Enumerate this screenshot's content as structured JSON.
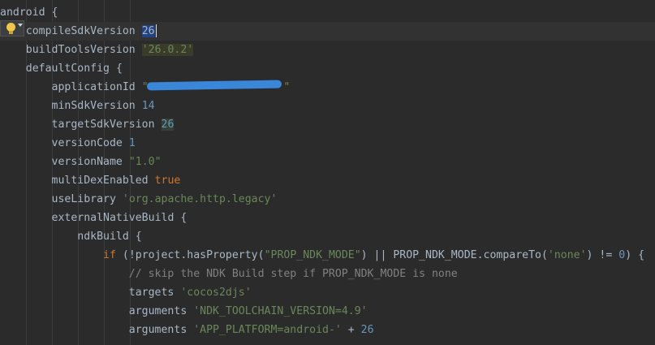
{
  "code": {
    "l1": {
      "ident": "android",
      "brace": "{"
    },
    "l2": {
      "ident": "compileSdkVersion",
      "value": "26"
    },
    "l3": {
      "ident": "buildToolsVersion",
      "value": "'26.0.2'"
    },
    "l4": {
      "ident": "defaultConfig",
      "brace": "{"
    },
    "l5": {
      "ident": "applicationId",
      "open_quote": "\"",
      "close_quote": "\""
    },
    "l6": {
      "ident": "minSdkVersion",
      "value": "14"
    },
    "l7": {
      "ident": "targetSdkVersion",
      "value": "26"
    },
    "l8": {
      "ident": "versionCode",
      "value": "1"
    },
    "l9": {
      "ident": "versionName",
      "value": "\"1.0\""
    },
    "l10": {
      "ident": "multiDexEnabled",
      "value": "true"
    },
    "l11": {
      "ident": "useLibrary",
      "value": "'org.apache.http.legacy'"
    },
    "l12": {
      "ident": "externalNativeBuild",
      "brace": "{"
    },
    "l13": {
      "ident": "ndkBuild",
      "brace": "{"
    },
    "l14": {
      "kw_if": "if",
      "part1": " (!project.hasProperty(",
      "str1": "\"PROP_NDK_MODE\"",
      "part2": ") || PROP_NDK_MODE.compareTo(",
      "str2": "'none'",
      "part3": ") != ",
      "num": "0",
      "part4": ") {"
    },
    "l15": {
      "comment": "// skip the NDK Build step if PROP_NDK_MODE is none"
    },
    "l16": {
      "ident": "targets",
      "value": "'cocos2djs'"
    },
    "l17": {
      "ident": "arguments",
      "value": "'NDK_TOOLCHAIN_VERSION=4.9'"
    },
    "l18": {
      "ident": "arguments",
      "value": "'APP_PLATFORM=android-'",
      "op": " + ",
      "num": "26"
    }
  },
  "colors": {
    "background": "#2b2b2b",
    "keyword": "#cc7832",
    "string": "#6a8759",
    "number": "#6897bb",
    "comment": "#808080",
    "redaction": "#3a86d8"
  },
  "icons": {
    "intention": "lightbulb-icon"
  }
}
